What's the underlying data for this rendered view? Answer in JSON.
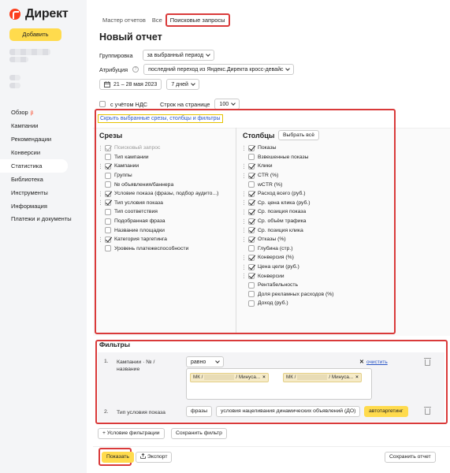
{
  "sidebar": {
    "logo": "Директ",
    "add_button": "Добавить",
    "nav": [
      {
        "label": "Обзор",
        "badge": "β"
      },
      {
        "label": "Кампании"
      },
      {
        "label": "Рекомендации"
      },
      {
        "label": "Конверсии"
      },
      {
        "label": "Статистика"
      },
      {
        "label": "Библиотека"
      },
      {
        "label": "Инструменты"
      },
      {
        "label": "Информация"
      },
      {
        "label": "Платежи и документы"
      }
    ]
  },
  "breadcrumbs": [
    "Мастер отчетов",
    "Все",
    "Поисковые запросы"
  ],
  "title": "Новый отчет",
  "settings": {
    "grouping_label": "Группировка",
    "grouping_value": "за выбранный период",
    "attribution_label": "Атрибуция",
    "attribution_value": "последний переход из Яндекс.Директа кросс-девайс",
    "date_range": "21 – 28 мая 2023",
    "period": "7 дней",
    "vat_label": "с учётом НДС",
    "rows_label": "Строк на странице",
    "rows_value": "100"
  },
  "hide_link": "Скрыть выбранные срезы, столбцы и фильтры",
  "slices": {
    "title": "Срезы",
    "items": [
      {
        "label": "Поисковый запрос",
        "checked": true,
        "disabled": true
      },
      {
        "label": "Тип кампании",
        "checked": false
      },
      {
        "label": "Кампании",
        "checked": true
      },
      {
        "label": "Группы",
        "checked": false
      },
      {
        "label": "№ объявления/баннера",
        "checked": false
      },
      {
        "label": "Условие показа (фразы, подбор аудито...)",
        "checked": true
      },
      {
        "label": "Тип условия показа",
        "checked": true
      },
      {
        "label": "Тип соответствия",
        "checked": false
      },
      {
        "label": "Подобранная фраза",
        "checked": false
      },
      {
        "label": "Название площадки",
        "checked": false
      },
      {
        "label": "Категория таргетинга",
        "checked": true
      },
      {
        "label": "Уровень платежеспособности",
        "checked": false
      }
    ]
  },
  "columns": {
    "title": "Столбцы",
    "select_all": "Выбрать всё",
    "items": [
      {
        "label": "Показы",
        "checked": true
      },
      {
        "label": "Взвешенные показы",
        "checked": false
      },
      {
        "label": "Клики",
        "checked": true
      },
      {
        "label": "CTR (%)",
        "checked": true
      },
      {
        "label": "wCTR (%)",
        "checked": false
      },
      {
        "label": "Расход всего (руб.)",
        "checked": true
      },
      {
        "label": "Ср. цена клика (руб.)",
        "checked": true
      },
      {
        "label": "Ср. позиция показа",
        "checked": true
      },
      {
        "label": "Ср. объём трафика",
        "checked": true
      },
      {
        "label": "Ср. позиция клика",
        "checked": true
      },
      {
        "label": "Отказы (%)",
        "checked": true
      },
      {
        "label": "Глубина (стр.)",
        "checked": false
      },
      {
        "label": "Конверсия (%)",
        "checked": true
      },
      {
        "label": "Цена цели (руб.)",
        "checked": true
      },
      {
        "label": "Конверсии",
        "checked": true
      },
      {
        "label": "Рентабельность",
        "checked": false
      },
      {
        "label": "Доля рекламных расходов (%)",
        "checked": false
      },
      {
        "label": "Доход (руб.)",
        "checked": false
      }
    ]
  },
  "filters": {
    "title": "Фильтры",
    "f1": {
      "num": "1.",
      "label": "Кампании · № / название",
      "operator": "равно",
      "clear": "очистить",
      "chip1_prefix": "МК /",
      "chip1_suffix": "/ Минуса...",
      "chip2_prefix": "МК /",
      "chip2_suffix": "/ Минуса..."
    },
    "f2": {
      "num": "2.",
      "label": "Тип условия показа",
      "options": [
        "фразы",
        "условия нацеливания динамических объявлений (ДО)",
        "автотаргетинг"
      ]
    },
    "add_condition": "+ Условие фильтрации",
    "save_filter": "Сохранить фильтр"
  },
  "footer": {
    "show": "Показать",
    "export": "Экспорт",
    "save_report": "Сохранить отчет"
  },
  "colors": {
    "accent": "#ffdb4d",
    "highlight": "#d93a3a",
    "link": "#2a56c6"
  }
}
